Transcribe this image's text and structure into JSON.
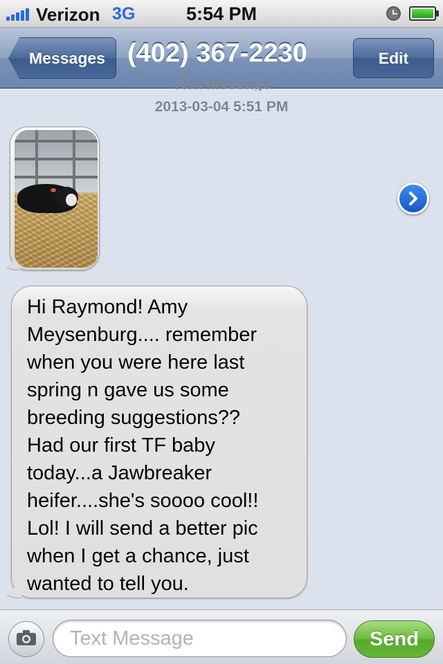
{
  "status_bar": {
    "carrier": "Verizon",
    "network": "3G",
    "time": "5:54 PM",
    "signal_bars": 5,
    "battery_level": 1.0,
    "alarm_icon": "alarm-clock-icon",
    "battery_icon": "battery-icon"
  },
  "nav": {
    "back_label": "Messages",
    "title": "(402) 367-2230",
    "edit_label": "Edit"
  },
  "conversation": {
    "clipped_header": "Text Message",
    "timestamp": "2013-03-04 5:51 PM",
    "photo_message": {
      "icon": "photo-thumbnail",
      "forward_icon": "chevron-right-circle-icon"
    },
    "text_message": "Hi Raymond! Amy\nMeysenburg.... remember\nwhen you were here last\nspring n gave us some\nbreeding suggestions??\nHad our first TF baby\ntoday...a Jawbreaker\nheifer....she's soooo cool!!\nLol! I will send a better pic\nwhen I get a chance, just\nwanted to tell you."
  },
  "input_bar": {
    "camera_icon": "camera-icon",
    "placeholder": "Text Message",
    "value": "",
    "send_label": "Send"
  },
  "colors": {
    "background": "#dbe2ed",
    "nav_blue": "#6d86ae",
    "accent_blue": "#2a6ad8",
    "send_green": "#6cbb3f",
    "bubble_gray": "#e0e0e0"
  }
}
